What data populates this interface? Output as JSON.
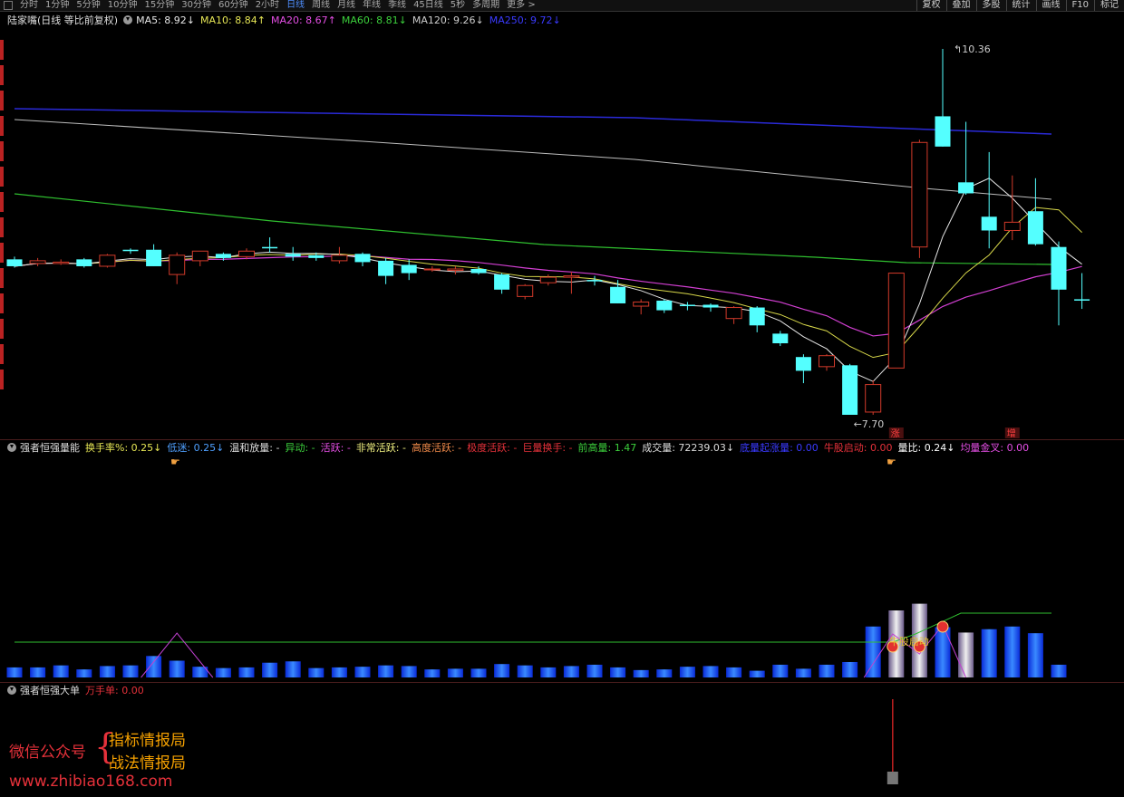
{
  "toolbar": {
    "tabs": [
      "分时",
      "1分钟",
      "5分钟",
      "10分钟",
      "15分钟",
      "30分钟",
      "60分钟",
      "2小时",
      "日线",
      "周线",
      "月线",
      "年线",
      "季线",
      "45日线",
      "5秒",
      "多周期",
      "更多 >"
    ],
    "active_tab": "日线",
    "buttons": [
      "复权",
      "叠加",
      "多股",
      "统计",
      "画线",
      "F10",
      "标记"
    ]
  },
  "main_panel": {
    "title": "陆家嘴(日线 等比前复权)",
    "ma": [
      {
        "label": "MA5: 8.92",
        "arrow": "↓",
        "color": "#e6e6e6"
      },
      {
        "label": "MA10: 8.84",
        "arrow": "↑",
        "color": "#e6e655"
      },
      {
        "label": "MA20: 8.67",
        "arrow": "↑",
        "color": "#e44ee4"
      },
      {
        "label": "MA60: 8.81",
        "arrow": "↓",
        "color": "#3ccf3c"
      },
      {
        "label": "MA120: 9.26",
        "arrow": "↓",
        "color": "#cccccc"
      },
      {
        "label": "MA250: 9.72",
        "arrow": "↓",
        "color": "#3a3aff"
      }
    ],
    "high_label": "10.36",
    "low_label": "7.70",
    "marker_zhang": "涨",
    "marker_zeng": "增"
  },
  "mid_panel": {
    "title": "强者恒强量能",
    "items": [
      {
        "text": "换手率%: 0.25",
        "arrow": "↓",
        "color": "#e6e655"
      },
      {
        "text": "低迷: 0.25",
        "arrow": "↓",
        "color": "#4fa0ff"
      },
      {
        "text": "温和放量: -",
        "arrow": "",
        "color": "#dddddd"
      },
      {
        "text": "异动: -",
        "arrow": "",
        "color": "#3ccf3c"
      },
      {
        "text": "活跃: -",
        "arrow": "",
        "color": "#e44ee4"
      },
      {
        "text": "非常活跃: -",
        "arrow": "",
        "color": "#f0f080"
      },
      {
        "text": "高度活跃: -",
        "arrow": "",
        "color": "#f08a4a"
      },
      {
        "text": "极度活跃: -",
        "arrow": "",
        "color": "#e5313a"
      },
      {
        "text": "巨量换手: -",
        "arrow": "",
        "color": "#e5313a"
      },
      {
        "text": "前高量: 1.47",
        "arrow": "",
        "color": "#3ccf3c"
      },
      {
        "text": "成交量: 72239.03",
        "arrow": "↓",
        "color": "#dddddd"
      },
      {
        "text": "底量起涨量: 0.00",
        "arrow": "",
        "color": "#3a3aff"
      },
      {
        "text": "牛股启动: 0.00",
        "arrow": "",
        "color": "#e5313a"
      },
      {
        "text": "量比: 0.24",
        "arrow": "↓",
        "color": "#ffffff"
      },
      {
        "text": "均量金叉: 0.00",
        "arrow": "",
        "color": "#e44ee4"
      }
    ],
    "signal_label": "牛股启动"
  },
  "bottom_panel": {
    "title": "强者恒强大单",
    "item": "万手单: 0.00"
  },
  "watermark": {
    "wechat": "微信公众号",
    "line1": "指标情报局",
    "line2": "战法情报局",
    "site": "www.zhibiao168.com"
  },
  "chart_data": {
    "type": "candlestick",
    "price_range": [
      7.7,
      10.36
    ],
    "candles": [
      [
        8.83,
        8.78,
        8.85,
        8.77
      ],
      [
        8.8,
        8.82,
        8.84,
        8.78
      ],
      [
        8.8,
        8.81,
        8.83,
        8.79
      ],
      [
        8.83,
        8.78,
        8.84,
        8.77
      ],
      [
        8.78,
        8.86,
        8.87,
        8.77
      ],
      [
        8.9,
        8.89,
        8.91,
        8.87
      ],
      [
        8.9,
        8.78,
        8.94,
        8.78
      ],
      [
        8.72,
        8.86,
        8.88,
        8.65
      ],
      [
        8.82,
        8.89,
        8.89,
        8.78
      ],
      [
        8.87,
        8.84,
        8.88,
        8.82
      ],
      [
        8.85,
        8.89,
        8.91,
        8.83
      ],
      [
        8.92,
        8.91,
        8.99,
        8.88
      ],
      [
        8.87,
        8.85,
        8.92,
        8.82
      ],
      [
        8.86,
        8.84,
        8.88,
        8.82
      ],
      [
        8.82,
        8.86,
        8.92,
        8.8
      ],
      [
        8.87,
        8.81,
        8.88,
        8.78
      ],
      [
        8.82,
        8.71,
        8.84,
        8.65
      ],
      [
        8.79,
        8.73,
        8.83,
        8.68
      ],
      [
        8.76,
        8.76,
        8.78,
        8.74
      ],
      [
        8.75,
        8.76,
        8.78,
        8.72
      ],
      [
        8.76,
        8.73,
        8.78,
        8.72
      ],
      [
        8.72,
        8.61,
        8.73,
        8.58
      ],
      [
        8.56,
        8.64,
        8.65,
        8.54
      ],
      [
        8.66,
        8.7,
        8.72,
        8.64
      ],
      [
        8.7,
        8.71,
        8.74,
        8.58
      ],
      [
        8.68,
        8.67,
        8.71,
        8.64
      ],
      [
        8.63,
        8.51,
        8.68,
        8.51
      ],
      [
        8.49,
        8.52,
        8.54,
        8.43
      ],
      [
        8.53,
        8.46,
        8.54,
        8.44
      ],
      [
        8.5,
        8.49,
        8.52,
        8.46
      ],
      [
        8.5,
        8.48,
        8.51,
        8.45
      ],
      [
        8.4,
        8.48,
        8.49,
        8.36
      ],
      [
        8.48,
        8.35,
        8.49,
        8.3
      ],
      [
        8.29,
        8.22,
        8.31,
        8.2
      ],
      [
        8.12,
        8.02,
        8.14,
        7.93
      ],
      [
        8.05,
        8.13,
        8.14,
        8.02
      ],
      [
        8.06,
        7.7,
        8.07,
        7.7
      ],
      [
        7.72,
        7.92,
        7.95,
        7.7
      ],
      [
        8.04,
        8.73,
        8.73,
        8.04
      ],
      [
        8.92,
        9.68,
        9.7,
        8.84
      ],
      [
        9.87,
        9.65,
        10.36,
        9.65
      ],
      [
        9.39,
        9.31,
        9.83,
        9.3
      ],
      [
        9.14,
        9.04,
        9.61,
        8.91
      ],
      [
        9.04,
        9.1,
        9.44,
        8.97
      ],
      [
        9.18,
        8.94,
        9.42,
        8.93
      ],
      [
        8.92,
        8.61,
        8.96,
        8.35
      ],
      [
        8.54,
        8.53,
        8.73,
        8.47
      ]
    ],
    "volumes": [
      0.15,
      0.15,
      0.18,
      0.12,
      0.17,
      0.18,
      0.32,
      0.25,
      0.16,
      0.14,
      0.15,
      0.22,
      0.24,
      0.14,
      0.15,
      0.16,
      0.18,
      0.17,
      0.12,
      0.13,
      0.13,
      0.2,
      0.18,
      0.15,
      0.17,
      0.19,
      0.15,
      0.11,
      0.12,
      0.16,
      0.17,
      0.15,
      0.1,
      0.19,
      0.13,
      0.19,
      0.23,
      0.76,
      1.0,
      1.1,
      0.75,
      0.67,
      0.72,
      0.76,
      0.66,
      0.19
    ],
    "special_bars": [
      38,
      39,
      41
    ]
  }
}
